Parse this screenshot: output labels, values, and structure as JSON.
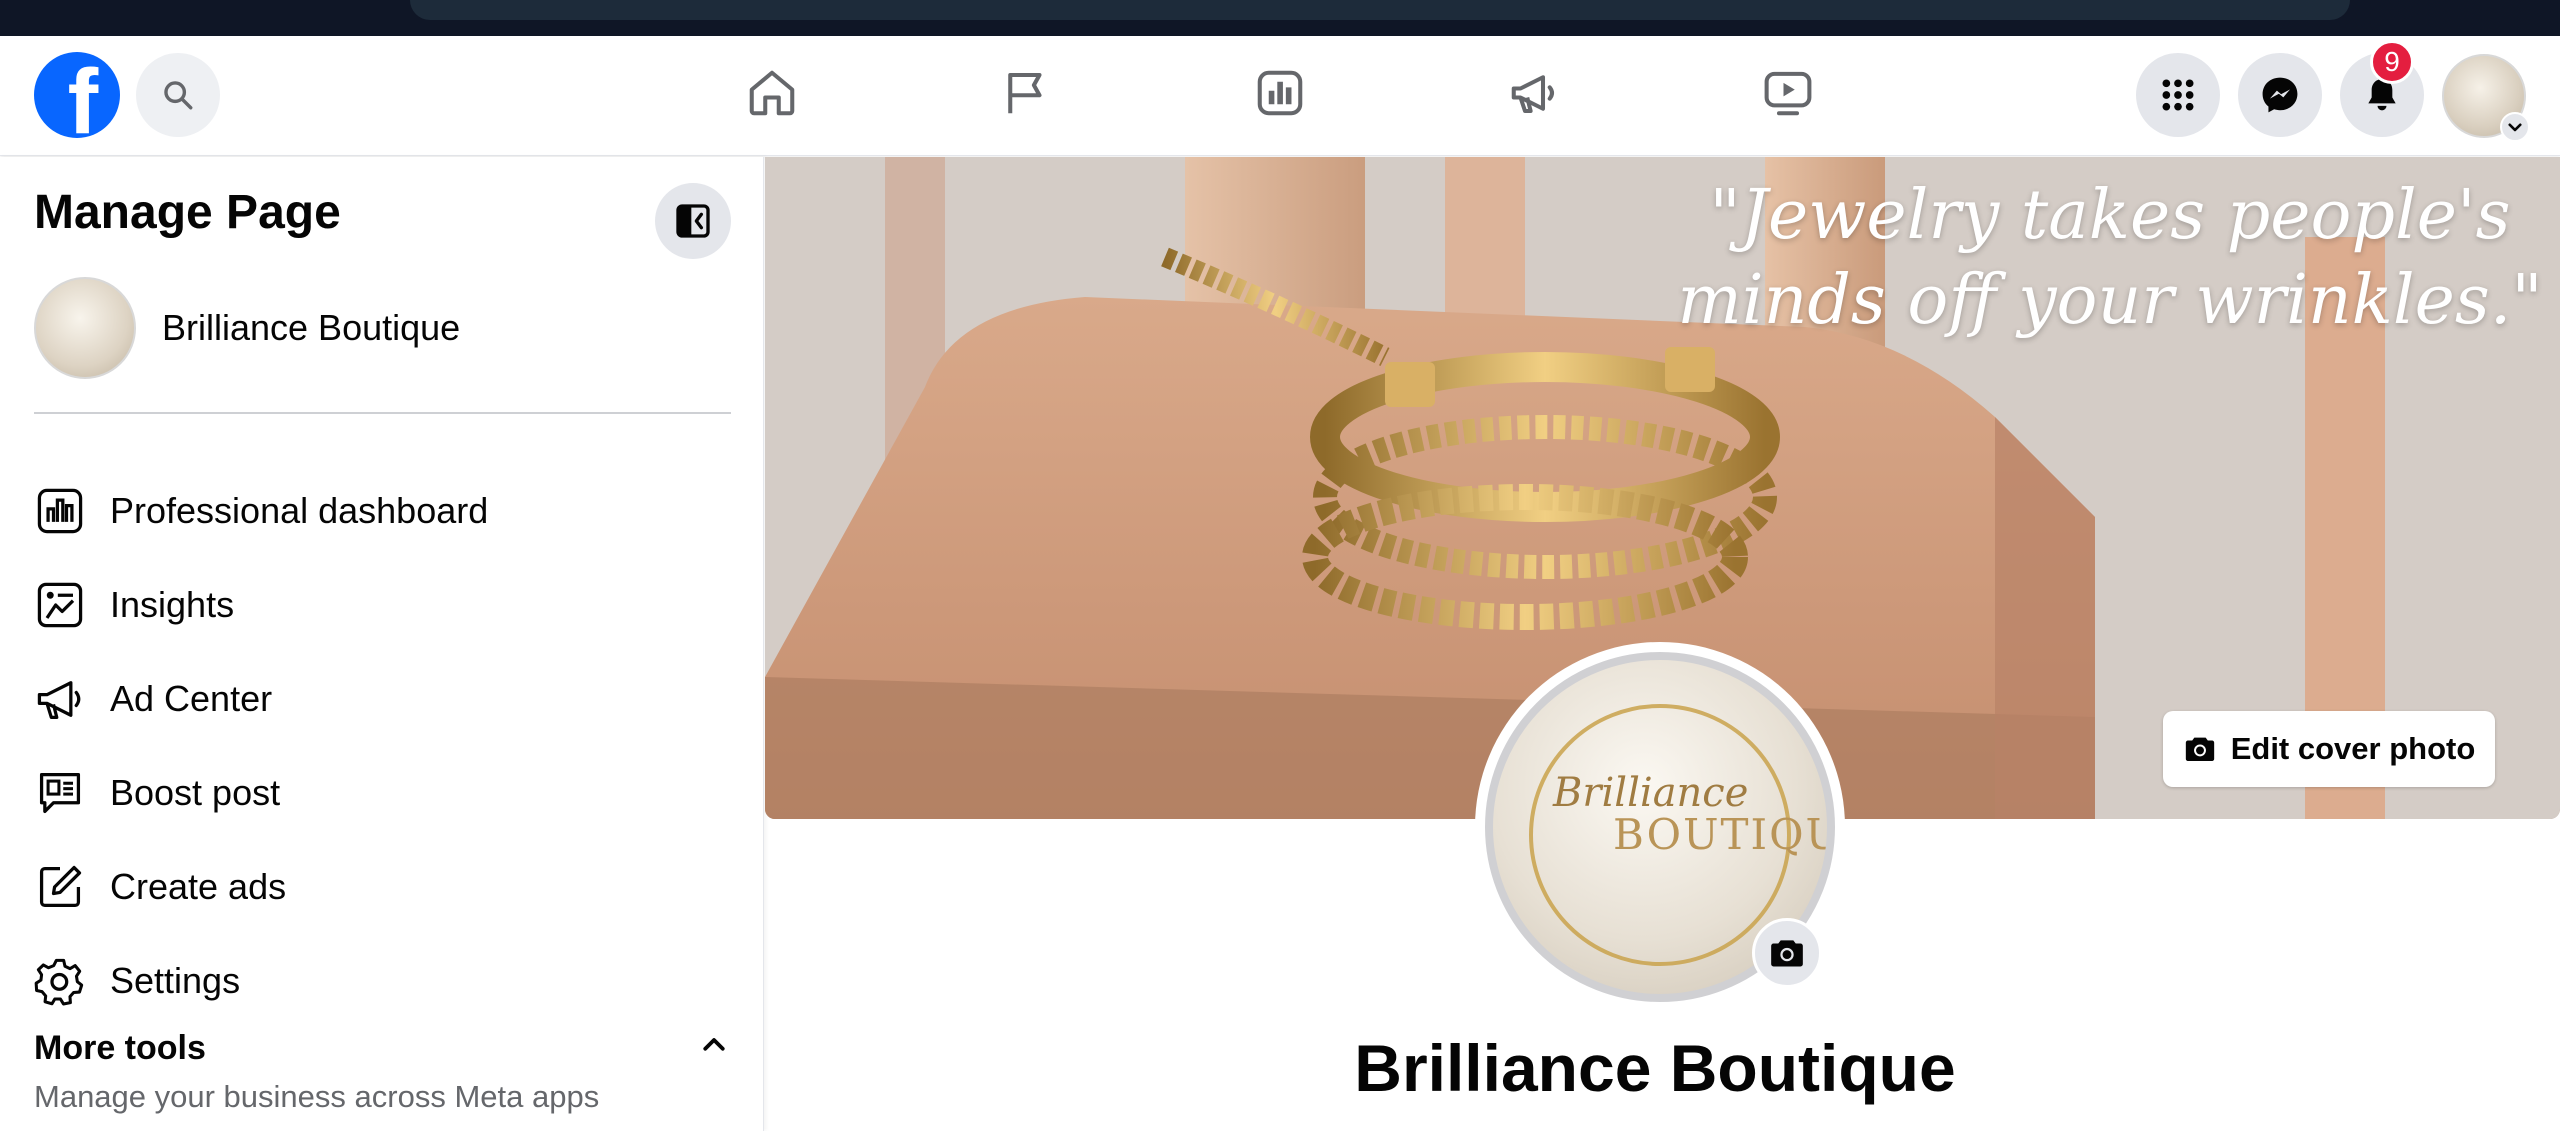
{
  "nav": {
    "logo_letter": "f",
    "notifications_count": "9"
  },
  "sidebar": {
    "title": "Manage Page",
    "page_name": "Brilliance Boutique",
    "items": [
      {
        "label": "Professional dashboard",
        "icon": "dashboard-icon"
      },
      {
        "label": "Insights",
        "icon": "insights-icon"
      },
      {
        "label": "Ad Center",
        "icon": "megaphone-icon"
      },
      {
        "label": "Boost post",
        "icon": "boost-post-icon"
      },
      {
        "label": "Create ads",
        "icon": "edit-icon"
      },
      {
        "label": "Settings",
        "icon": "gear-icon"
      }
    ],
    "more_tools": {
      "title": "More tools",
      "subtitle": "Manage your business across Meta apps"
    }
  },
  "cover": {
    "quote": "\"Jewelry takes people's minds off your wrinkles.\"",
    "edit_button_label": "Edit cover photo"
  },
  "profile": {
    "logo_line1": "Brilliance",
    "logo_line2": "BOUTIQUE",
    "page_title": "Brilliance Boutique"
  },
  "colors": {
    "brand_blue": "#0866ff",
    "badge_red": "#e41e3f"
  }
}
